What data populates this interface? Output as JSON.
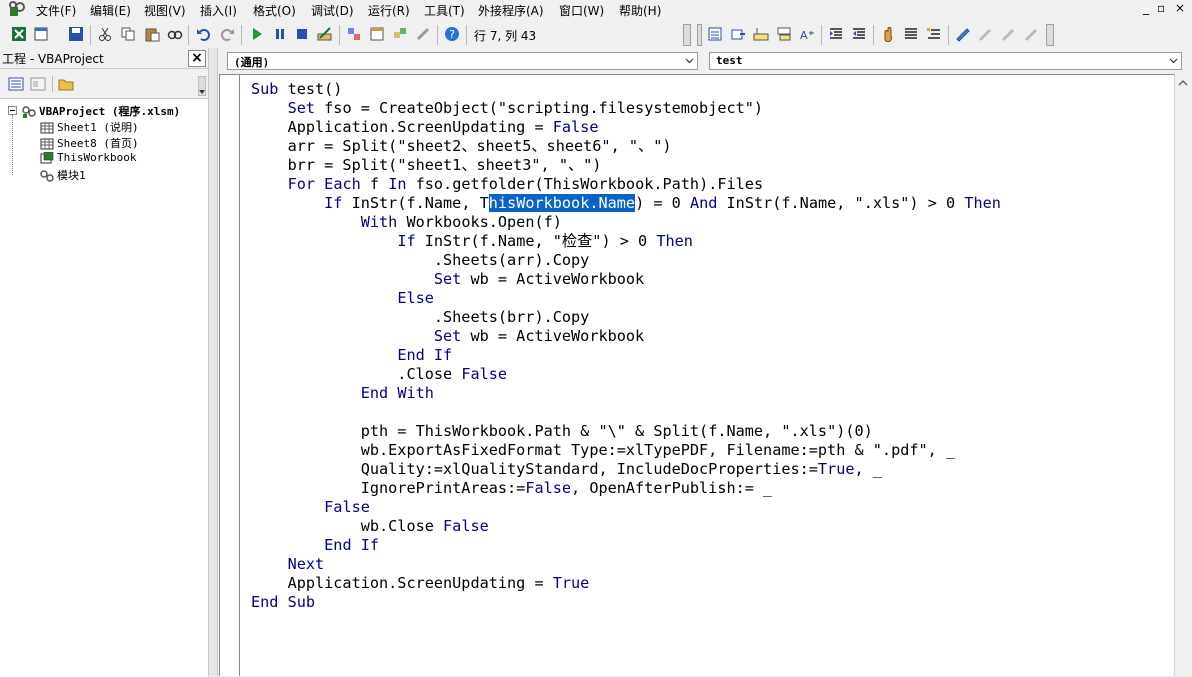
{
  "menu": [
    "文件(F)",
    "编辑(E)",
    "视图(V)",
    "插入(I)",
    "格式(O)",
    "调试(D)",
    "运行(R)",
    "工具(T)",
    "外接程序(A)",
    "窗口(W)",
    "帮助(H)"
  ],
  "window_controls": [
    "_",
    "▫",
    "×"
  ],
  "toolbar": {
    "cursor_position": "行 7, 列 43"
  },
  "project": {
    "title": "工程 - VBAProject",
    "close_label": "×",
    "root": "VBAProject (程序.xlsm)",
    "items": [
      "Sheet1 (说明)",
      "Sheet8 (首页)",
      "ThisWorkbook",
      "模块1"
    ]
  },
  "code_window": {
    "object_combo": "(通用)",
    "procedure_combo": "test"
  },
  "colors": {
    "keyword": "#00008b",
    "selection": "#0a64c8"
  },
  "code": {
    "l1": "Sub test()",
    "l2": "    Set fso = CreateObject(\"scripting.filesystemobject\")",
    "l3": "    Application.ScreenUpdating = False",
    "l4": "    arr = Split(\"sheet2、sheet5、sheet6\", \"、\")",
    "l5": "    brr = Split(\"sheet1、sheet3\", \"、\")",
    "l6": "    For Each f In fso.getfolder(ThisWorkbook.Path).Files",
    "l7a": "        If InStr(f.Name, T",
    "l7sel": "hisWorkbook.Name",
    "l7b": ") = 0 And InStr(f.Name, \".xls\") > 0 Then",
    "l8": "            With Workbooks.Open(f)",
    "l9": "                If InStr(f.Name, \"检查\") > 0 Then",
    "l10": "                    .Sheets(arr).Copy",
    "l11": "                    Set wb = ActiveWorkbook",
    "l12": "                Else",
    "l13": "                    .Sheets(brr).Copy",
    "l14": "                    Set wb = ActiveWorkbook",
    "l15": "                End If",
    "l16": "                .Close False",
    "l17": "            End With",
    "l18": "",
    "l19": "            pth = ThisWorkbook.Path & \"\\\" & Split(f.Name, \".xls\")(0)",
    "l20": "            wb.ExportAsFixedFormat Type:=xlTypePDF, Filename:=pth & \".pdf\", _",
    "l21": "            Quality:=xlQualityStandard, IncludeDocProperties:=True, _",
    "l22": "            IgnorePrintAreas:=False, OpenAfterPublish:= _",
    "l23": "        False",
    "l24": "            wb.Close False",
    "l25": "        End If",
    "l26": "    Next",
    "l27": "    Application.ScreenUpdating = True",
    "l28": "End Sub"
  }
}
